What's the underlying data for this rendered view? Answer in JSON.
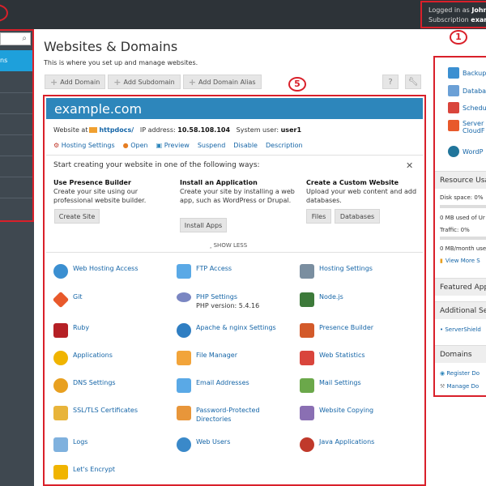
{
  "header": {
    "logged_in_prefix": "Logged in as",
    "user": "John",
    "subscription_prefix": "Subscription",
    "subscription": "exar",
    "marker_1": "1"
  },
  "sidebar": {
    "active_item": "ns",
    "search_icon": "search-icon"
  },
  "page": {
    "title": "Websites & Domains",
    "subtitle": "This is where you set up and manage websites."
  },
  "toolbar": {
    "add_domain": "Add Domain",
    "add_subdomain": "Add Subdomain",
    "add_domain_alias": "Add Domain Alias",
    "help_icon": "?",
    "settings_icon": "wrench-icon"
  },
  "domain": {
    "marker_5": "5",
    "name": "example.com",
    "website_at": "Website at",
    "docroot": "httpdocs/",
    "ip_label": "IP address:",
    "ip": "10.58.108.104",
    "user_label": "System user:",
    "user": "user1",
    "links": [
      "Hosting Settings",
      "Open",
      "Preview",
      "Suspend",
      "Disable",
      "Description"
    ]
  },
  "start": {
    "title": "Start creating your website in one of the following ways:",
    "presence": {
      "heading": "Use Presence Builder",
      "text": "Create your site using our professional website builder.",
      "button": "Create Site"
    },
    "install": {
      "heading": "Install an Application",
      "text": "Create your site by installing a web app, such as WordPress or Drupal.",
      "button": "Install Apps"
    },
    "custom": {
      "heading": "Create a Custom Website",
      "text": "Upload your web content and add databases.",
      "button_files": "Files",
      "button_databases": "Databases"
    },
    "show_less": "SHOW LESS"
  },
  "features": [
    "Web Hosting Access",
    "FTP Access",
    "Hosting Settings",
    "Git",
    "PHP Settings",
    "Node.js",
    "Ruby",
    "Apache & nginx Settings",
    "Presence Builder",
    "Applications",
    "File Manager",
    "Web Statistics",
    "DNS Settings",
    "Email Addresses",
    "Mail Settings",
    "SSL/TLS Certificates",
    "Password-Protected Directories",
    "Website Copying",
    "Logs",
    "Web Users",
    "Java Applications",
    "Let's Encrypt"
  ],
  "php_version": "PHP version: 5.4.16",
  "colors": {
    "accent": "#2d86bb",
    "annotation": "#d9202a",
    "sidebar": "#3f4850",
    "topbar": "#2d3338"
  },
  "right": {
    "links": [
      "Backup",
      "Databa",
      "Schedu",
      "Server",
      "CloudF",
      "WordP"
    ],
    "resource_usage": "Resource Usa",
    "disk_space": "Disk space: 0%",
    "disk_used": "0 MB used of Ur",
    "traffic": "Traffic: 0%",
    "traffic_used": "0 MB/month use",
    "view_more": "View More S",
    "featured_apps": "Featured App",
    "additional_services": "Additional Se",
    "servershield": "ServerShield",
    "domains": "Domains",
    "register_domain": "Register Do",
    "manage_domains": "Manage Do"
  }
}
